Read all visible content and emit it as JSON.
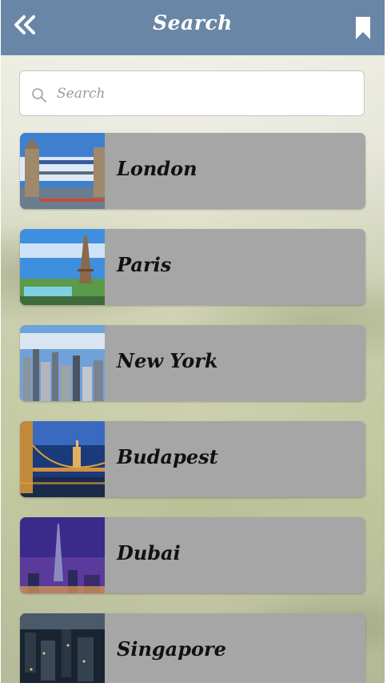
{
  "header": {
    "title": "Search",
    "back_icon": "double-chevron-left-icon",
    "bookmark_icon": "bookmark-icon",
    "background_color": "#6a86a6"
  },
  "search": {
    "placeholder": "Search",
    "value": "",
    "icon": "search-icon"
  },
  "cities": [
    {
      "label": "London",
      "thumbnail": "tower-bridge-photo"
    },
    {
      "label": "Paris",
      "thumbnail": "eiffel-tower-photo"
    },
    {
      "label": "New York",
      "thumbnail": "manhattan-skyline-photo"
    },
    {
      "label": "Budapest",
      "thumbnail": "chain-bridge-night-photo"
    },
    {
      "label": "Dubai",
      "thumbnail": "burj-khalifa-night-photo"
    },
    {
      "label": "Singapore",
      "thumbnail": "city-night-aerial-photo"
    }
  ],
  "colors": {
    "list_item_bg": "#a6a6a6",
    "list_text": "#111111"
  }
}
